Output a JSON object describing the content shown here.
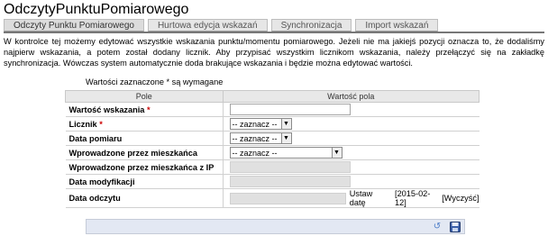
{
  "page_title": "OdczytyPunktuPomiarowego",
  "tabs": [
    {
      "label": "Odczyty Punktu Pomiarowego"
    },
    {
      "label": "Hurtowa edycja wskazań"
    },
    {
      "label": "Synchronizacja"
    },
    {
      "label": "Import wskazań"
    }
  ],
  "intro_text": "W kontrolce tej możemy edytować wszystkie wskazania punktu/momentu pomiarowego. Jeżeli nie ma jakiejś pozycji oznacza to, że dodaliśmy najpierw wskazania, a potem został dodany licznik. Aby przypisać wszystkim licznikom wskazania, należy przełączyć się na zakładkę synchronizacja. Wówczas system automatycznie doda brakujące wskazania i będzie można edytować wartości.",
  "required_note": "Wartości zaznaczone * są wymagane",
  "table": {
    "col_field": "Pole",
    "col_value": "Wartość pola",
    "rows": {
      "wskazanie": {
        "label": "Wartość wskazania",
        "required": "*"
      },
      "licznik": {
        "label": "Licznik",
        "required": "*",
        "selected": "-- zaznacz --"
      },
      "data_pomiaru": {
        "label": "Data pomiaru",
        "selected": "-- zaznacz --"
      },
      "wprowadzone": {
        "label": "Wprowadzone przez mieszkańca",
        "selected": "-- zaznacz --"
      },
      "wprowadzone_ip": {
        "label": "Wprowadzone przez mieszkańca z IP"
      },
      "data_modyfikacji": {
        "label": "Data modyfikacji"
      },
      "data_odczytu": {
        "label": "Data odczytu",
        "set_date": "Ustaw datę",
        "date_value": "[2015-02-12]",
        "clear": "[Wyczyść]"
      }
    }
  },
  "footer": {
    "refresh_icon": "refresh-icon",
    "save_icon": "save-icon"
  }
}
